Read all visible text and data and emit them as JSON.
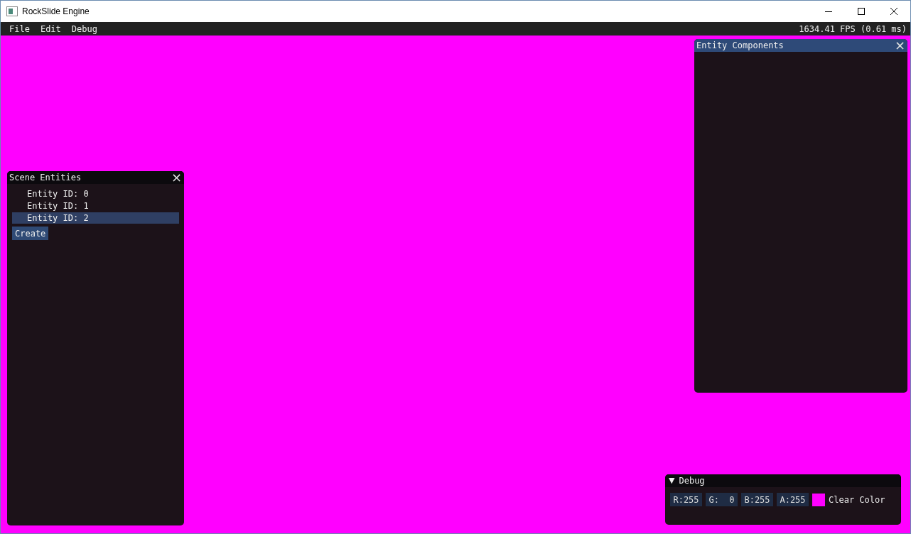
{
  "window": {
    "title": "RockSlide Engine"
  },
  "menu": [
    "File",
    "Edit",
    "Debug"
  ],
  "fps": "1634.41 FPS (0.61 ms)",
  "scene_entities": {
    "title": "Scene Entities",
    "active": false,
    "close": "×",
    "items": [
      {
        "label": "Entity ID: 0",
        "selected": false
      },
      {
        "label": "Entity ID: 1",
        "selected": false
      },
      {
        "label": "Entity ID: 2",
        "selected": true
      }
    ],
    "create": "Create"
  },
  "entity_components": {
    "title": "Entity Components",
    "active": true,
    "close": "×"
  },
  "debug": {
    "title": "Debug",
    "arrow": "▼",
    "expanded": true,
    "channels": [
      "R:255",
      "G:  0",
      "B:255",
      "A:255"
    ],
    "swatch": {
      "color": "#ff00ff"
    },
    "label": "Clear Color"
  }
}
